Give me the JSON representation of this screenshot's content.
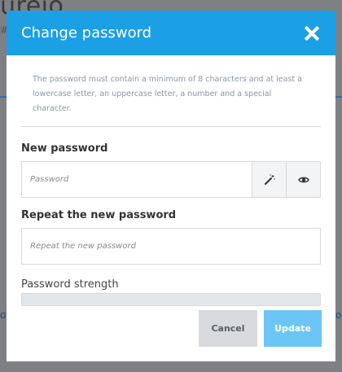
{
  "background": {
    "title_fragment": "ureio",
    "subtitle_fragment": "#",
    "left_fragment": "ot",
    "right_fragment": "o"
  },
  "modal": {
    "title": "Change password",
    "hint": "The password must contain a minimum of 8 characters and at least a lowercase letter, an uppercase letter, a number and a special character.",
    "new_password": {
      "label": "New password",
      "placeholder": "Password",
      "value": ""
    },
    "repeat_password": {
      "label": "Repeat the new password",
      "placeholder": "Repeat the new password",
      "value": ""
    },
    "strength": {
      "label": "Password strength",
      "level": 0
    },
    "buttons": {
      "cancel": "Cancel",
      "update": "Update"
    },
    "icons": {
      "close": "close-icon",
      "generate": "magic-wand-icon",
      "reveal": "eye-icon"
    },
    "colors": {
      "header": "#1ba0e6",
      "update_button": "#6cc6f5",
      "cancel_button": "#d8dadd"
    }
  }
}
